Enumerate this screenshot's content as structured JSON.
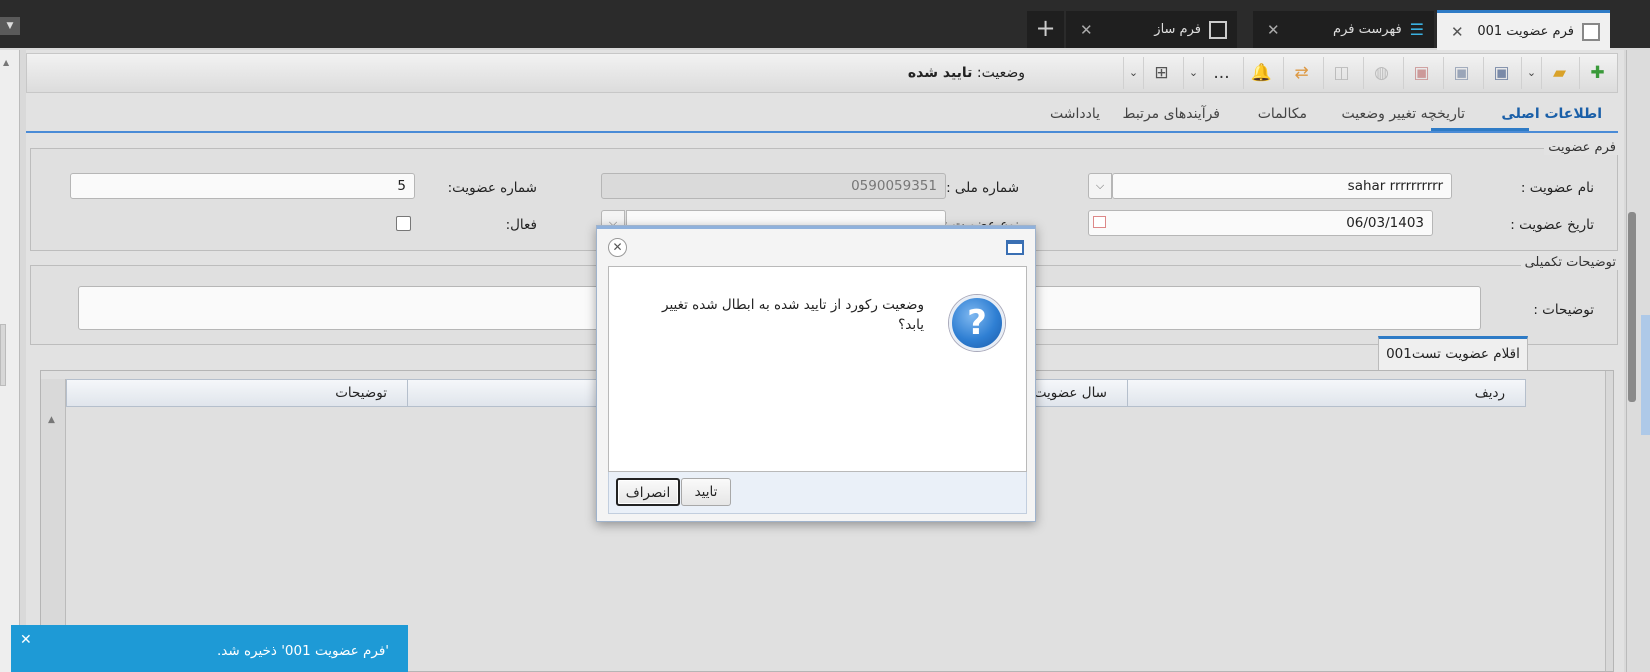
{
  "tabs": [
    {
      "label": "فرم عضویت 001",
      "active": true
    },
    {
      "label": "فهرست فرم",
      "active": false
    },
    {
      "label": "فرم ساز",
      "active": false
    }
  ],
  "toolbar": {
    "status_label": "وضعیت:",
    "status_value": "تایید شده",
    "more_label": "..."
  },
  "subtabs": [
    "اطلاعات اصلی",
    "تاریخچه تغییر وضعیت",
    "مکالمات",
    "فرآیندهای مرتبط",
    "یادداشت"
  ],
  "form_section": {
    "legend": "فرم عضویت",
    "name_label": "نام عضویت :",
    "name_value": "sahar rrrrrrrrrr",
    "national_id_label": "شماره ملی :",
    "national_id_value": "0590059351",
    "member_no_label": "شماره عضویت:",
    "member_no_value": "5",
    "date_label": "تاریخ عضویت :",
    "date_value": "06/03/1403",
    "type_label": "نوع عضویت :",
    "active_label": "فعال:"
  },
  "extra_section": {
    "legend": "توضیحات تکمیلی",
    "desc_label": "توضیحات :"
  },
  "grid": {
    "tab_label": "اقلام عضویت تست001",
    "columns": [
      "ردیف",
      "سال عضویت",
      "توضیحات"
    ]
  },
  "dialog": {
    "message": "وضعیت رکورد از تایید شده به ابطال شده تغییر یابد؟",
    "confirm_label": "تایید",
    "cancel_label": "انصراف",
    "icon": "question-icon"
  },
  "toast": {
    "message": "'فرم عضویت 001' ذخیره شد.",
    "color": "#1e9ad6"
  },
  "colors": {
    "accent": "#2e7bc6",
    "topbar": "#2b2b2b"
  }
}
